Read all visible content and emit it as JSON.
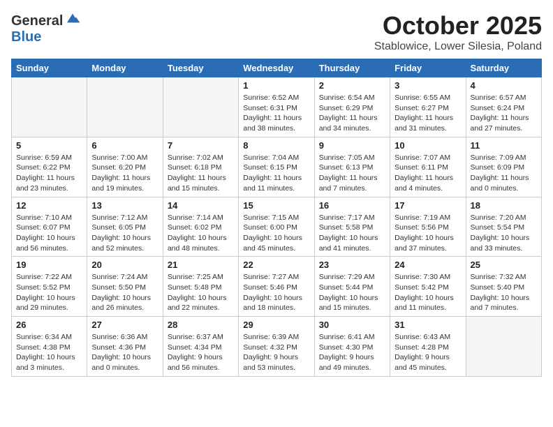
{
  "header": {
    "logo_general": "General",
    "logo_blue": "Blue",
    "month_title": "October 2025",
    "location": "Stablowice, Lower Silesia, Poland"
  },
  "weekdays": [
    "Sunday",
    "Monday",
    "Tuesday",
    "Wednesday",
    "Thursday",
    "Friday",
    "Saturday"
  ],
  "weeks": [
    [
      {
        "day": "",
        "info": ""
      },
      {
        "day": "",
        "info": ""
      },
      {
        "day": "",
        "info": ""
      },
      {
        "day": "1",
        "info": "Sunrise: 6:52 AM\nSunset: 6:31 PM\nDaylight: 11 hours\nand 38 minutes."
      },
      {
        "day": "2",
        "info": "Sunrise: 6:54 AM\nSunset: 6:29 PM\nDaylight: 11 hours\nand 34 minutes."
      },
      {
        "day": "3",
        "info": "Sunrise: 6:55 AM\nSunset: 6:27 PM\nDaylight: 11 hours\nand 31 minutes."
      },
      {
        "day": "4",
        "info": "Sunrise: 6:57 AM\nSunset: 6:24 PM\nDaylight: 11 hours\nand 27 minutes."
      }
    ],
    [
      {
        "day": "5",
        "info": "Sunrise: 6:59 AM\nSunset: 6:22 PM\nDaylight: 11 hours\nand 23 minutes."
      },
      {
        "day": "6",
        "info": "Sunrise: 7:00 AM\nSunset: 6:20 PM\nDaylight: 11 hours\nand 19 minutes."
      },
      {
        "day": "7",
        "info": "Sunrise: 7:02 AM\nSunset: 6:18 PM\nDaylight: 11 hours\nand 15 minutes."
      },
      {
        "day": "8",
        "info": "Sunrise: 7:04 AM\nSunset: 6:15 PM\nDaylight: 11 hours\nand 11 minutes."
      },
      {
        "day": "9",
        "info": "Sunrise: 7:05 AM\nSunset: 6:13 PM\nDaylight: 11 hours\nand 7 minutes."
      },
      {
        "day": "10",
        "info": "Sunrise: 7:07 AM\nSunset: 6:11 PM\nDaylight: 11 hours\nand 4 minutes."
      },
      {
        "day": "11",
        "info": "Sunrise: 7:09 AM\nSunset: 6:09 PM\nDaylight: 11 hours\nand 0 minutes."
      }
    ],
    [
      {
        "day": "12",
        "info": "Sunrise: 7:10 AM\nSunset: 6:07 PM\nDaylight: 10 hours\nand 56 minutes."
      },
      {
        "day": "13",
        "info": "Sunrise: 7:12 AM\nSunset: 6:05 PM\nDaylight: 10 hours\nand 52 minutes."
      },
      {
        "day": "14",
        "info": "Sunrise: 7:14 AM\nSunset: 6:02 PM\nDaylight: 10 hours\nand 48 minutes."
      },
      {
        "day": "15",
        "info": "Sunrise: 7:15 AM\nSunset: 6:00 PM\nDaylight: 10 hours\nand 45 minutes."
      },
      {
        "day": "16",
        "info": "Sunrise: 7:17 AM\nSunset: 5:58 PM\nDaylight: 10 hours\nand 41 minutes."
      },
      {
        "day": "17",
        "info": "Sunrise: 7:19 AM\nSunset: 5:56 PM\nDaylight: 10 hours\nand 37 minutes."
      },
      {
        "day": "18",
        "info": "Sunrise: 7:20 AM\nSunset: 5:54 PM\nDaylight: 10 hours\nand 33 minutes."
      }
    ],
    [
      {
        "day": "19",
        "info": "Sunrise: 7:22 AM\nSunset: 5:52 PM\nDaylight: 10 hours\nand 29 minutes."
      },
      {
        "day": "20",
        "info": "Sunrise: 7:24 AM\nSunset: 5:50 PM\nDaylight: 10 hours\nand 26 minutes."
      },
      {
        "day": "21",
        "info": "Sunrise: 7:25 AM\nSunset: 5:48 PM\nDaylight: 10 hours\nand 22 minutes."
      },
      {
        "day": "22",
        "info": "Sunrise: 7:27 AM\nSunset: 5:46 PM\nDaylight: 10 hours\nand 18 minutes."
      },
      {
        "day": "23",
        "info": "Sunrise: 7:29 AM\nSunset: 5:44 PM\nDaylight: 10 hours\nand 15 minutes."
      },
      {
        "day": "24",
        "info": "Sunrise: 7:30 AM\nSunset: 5:42 PM\nDaylight: 10 hours\nand 11 minutes."
      },
      {
        "day": "25",
        "info": "Sunrise: 7:32 AM\nSunset: 5:40 PM\nDaylight: 10 hours\nand 7 minutes."
      }
    ],
    [
      {
        "day": "26",
        "info": "Sunrise: 6:34 AM\nSunset: 4:38 PM\nDaylight: 10 hours\nand 3 minutes."
      },
      {
        "day": "27",
        "info": "Sunrise: 6:36 AM\nSunset: 4:36 PM\nDaylight: 10 hours\nand 0 minutes."
      },
      {
        "day": "28",
        "info": "Sunrise: 6:37 AM\nSunset: 4:34 PM\nDaylight: 9 hours\nand 56 minutes."
      },
      {
        "day": "29",
        "info": "Sunrise: 6:39 AM\nSunset: 4:32 PM\nDaylight: 9 hours\nand 53 minutes."
      },
      {
        "day": "30",
        "info": "Sunrise: 6:41 AM\nSunset: 4:30 PM\nDaylight: 9 hours\nand 49 minutes."
      },
      {
        "day": "31",
        "info": "Sunrise: 6:43 AM\nSunset: 4:28 PM\nDaylight: 9 hours\nand 45 minutes."
      },
      {
        "day": "",
        "info": ""
      }
    ]
  ]
}
